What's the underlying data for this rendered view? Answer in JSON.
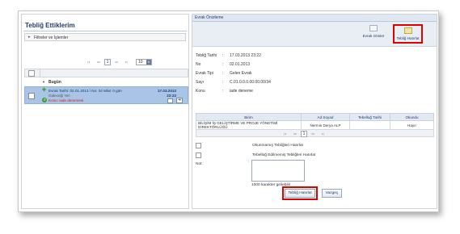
{
  "left": {
    "title": "Tebliğ Ettiklerim",
    "filter_label": "Filtreler ve İşlemler",
    "pager": {
      "first": "|◂",
      "prev": "◂◂",
      "page": "1",
      "next": "▸▸",
      "last": "▸|",
      "page_size": "10"
    },
    "group_label": "Bugün",
    "item": {
      "line1": "Evrak Tarihi: 02.01.2013 / No: 34 Mlat: 0 gün",
      "line2": "Gideceği Yer:",
      "line3": "Konu: iade denemesi",
      "date": "17.03.2013",
      "time": "23:22"
    }
  },
  "right": {
    "header": "Evrak Önizleme",
    "toolbar": {
      "show_doc": "Evrak Göster",
      "mark_read": "Tebliğ Hatırlat"
    },
    "info": [
      {
        "key": "Tebliğ Tarihi",
        "value": "17.03.2013 23:22"
      },
      {
        "key": "No",
        "value": "02.01.2013"
      },
      {
        "key": "Evrak Tipi",
        "value": "Gelen Evrak"
      },
      {
        "key": "Sayı",
        "value": "C.01.0.0.0.00.00.00/34"
      },
      {
        "key": "Konu",
        "value": "iade deneme"
      }
    ],
    "table": {
      "headers": [
        "Birim",
        "Ad Soyad",
        "Tebelluğ Tarihi",
        "Okundu"
      ],
      "rows": [
        [
          "BİLİŞİM İŞ GELİŞTİRME VE PROJE YÖNETİMİ DİREKTÖRLÜĞÜ",
          "Nermin Derya ALP",
          "",
          "Hayır"
        ]
      ],
      "pager": {
        "first": "|◂",
        "prev": "◂◂",
        "page": "1",
        "next": "▸▸",
        "last": "▸|"
      }
    },
    "checks": [
      "Okunmamış Tebliğleri Hatırlat",
      "Tebellüğ Edilmemiş Tebliğleri Hatırlat"
    ],
    "note_label": "Not",
    "note_colon": ":",
    "char_count": "1000 karakter girilebilir",
    "buttons": {
      "remind": "Tebliğ Hatırlat",
      "cancel": "Vazgeç"
    },
    "colon": ":"
  }
}
